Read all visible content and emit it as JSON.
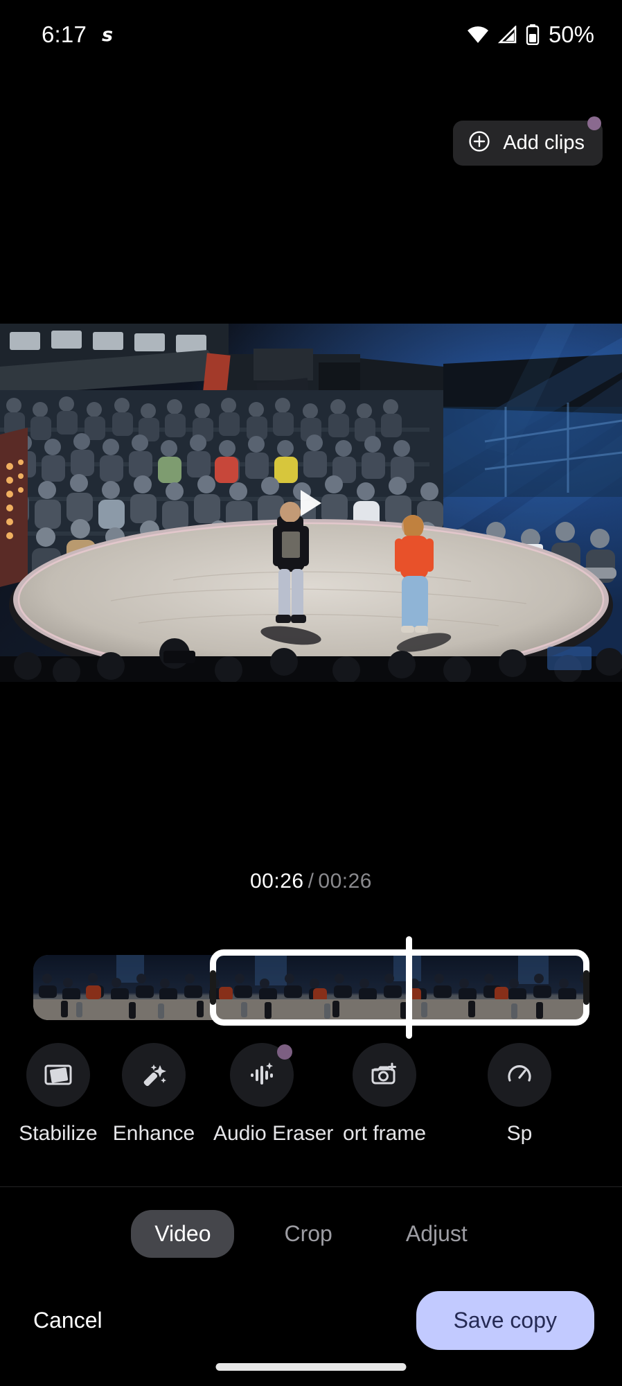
{
  "status_bar": {
    "time": "6:17",
    "app_icon": "s",
    "battery_percent": "50%",
    "icons": [
      "wifi-icon",
      "cellular-signal-icon",
      "battery-icon"
    ]
  },
  "header": {
    "add_clips_label": "Add clips",
    "add_clips_icon": "plus-circle-icon",
    "add_clips_badge": true
  },
  "preview": {
    "play_icon": "play-triangle-icon",
    "scene_description": "breakdance battle on a circular stage with crowd"
  },
  "playback": {
    "current_time": "00:26",
    "separator": "/",
    "total_time": "00:26"
  },
  "timeline": {
    "trim_left_handle": "trim-handle-left",
    "trim_right_handle": "trim-handle-right",
    "playhead": "playhead-marker"
  },
  "tools": [
    {
      "label": "Stabilize",
      "icon": "stabilize-icon",
      "badge": false
    },
    {
      "label": "Enhance",
      "icon": "magic-wand-icon",
      "badge": false
    },
    {
      "label": "Audio Eraser",
      "icon": "audio-eraser-icon",
      "badge": true
    },
    {
      "label": "ort frame",
      "icon": "export-frame-icon",
      "badge": false
    },
    {
      "label": "Sp",
      "icon": "speed-icon",
      "badge": false
    }
  ],
  "tabs": [
    {
      "label": "Video",
      "active": true
    },
    {
      "label": "Crop",
      "active": false
    },
    {
      "label": "Adjust",
      "active": false
    }
  ],
  "actions": {
    "cancel_label": "Cancel",
    "save_label": "Save copy"
  },
  "colors": {
    "background": "#000000",
    "surface": "#262628",
    "tool_circle": "#1b1c20",
    "accent_badge": "#8a6a8f",
    "save_button_bg": "#c2caff",
    "save_button_text": "#252a54",
    "tab_active_bg": "#45464b",
    "muted_text": "#8a8a8e"
  }
}
